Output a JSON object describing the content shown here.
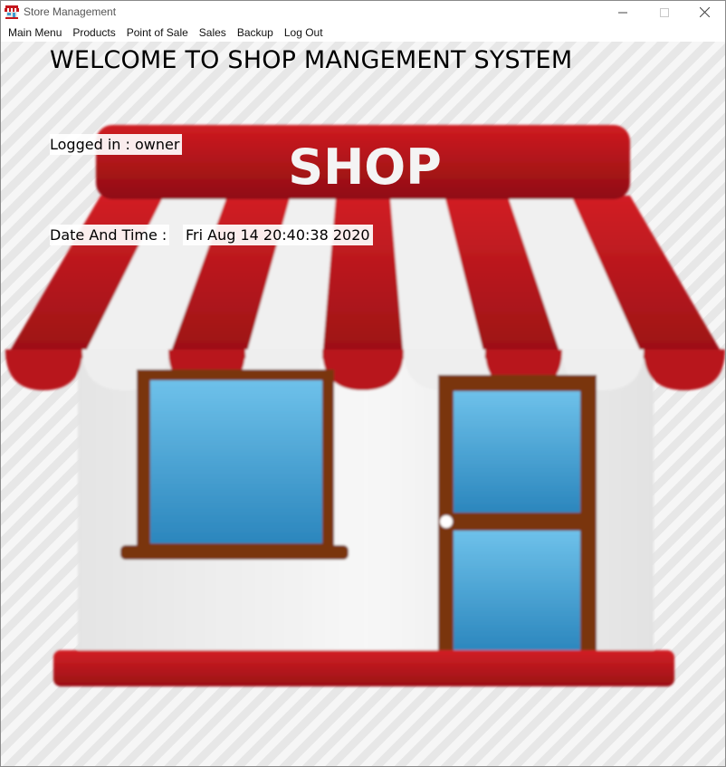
{
  "window": {
    "title": "Store Management",
    "app_icon": "shop-awning-icon",
    "controls": [
      "minimize-icon",
      "maximize-icon",
      "close-icon"
    ]
  },
  "menu": {
    "items": [
      {
        "label": "Main Menu"
      },
      {
        "label": "Products"
      },
      {
        "label": "Point of Sale"
      },
      {
        "label": "Sales"
      },
      {
        "label": "Backup"
      },
      {
        "label": "Log Out"
      }
    ]
  },
  "main": {
    "welcome": "WELCOME TO SHOP MANGEMENT SYSTEM",
    "logged_in_label": "Logged in : ",
    "logged_in_user": "owner",
    "datetime_label": "Date And Time : ",
    "datetime_value": "Fri Aug 14 20:40:38 2020",
    "background_image": {
      "icon": "shop-storefront-icon",
      "sign_text": "SHOP"
    }
  },
  "colors": {
    "awning_red": "#c4161c",
    "awning_dark_red": "#8f0e12",
    "window_blue": "#3a9ad0",
    "frame_brown": "#8a3a12",
    "wall": "#f2f2f2"
  }
}
